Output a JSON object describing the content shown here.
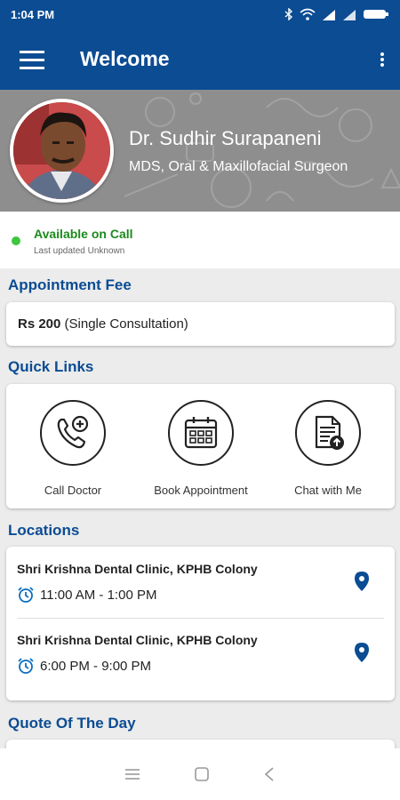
{
  "status_bar": {
    "time": "1:04 PM",
    "icons": [
      "bluetooth-icon",
      "wifi-icon",
      "signal-icon",
      "signal-icon",
      "battery-icon"
    ]
  },
  "app_bar": {
    "title": "Welcome"
  },
  "profile": {
    "name": "Dr. Sudhir Surapaneni",
    "degree": "MDS, Oral & Maxillofacial Surgeon"
  },
  "availability": {
    "status": "Available on Call",
    "updated": "Last updated Unknown",
    "status_color": "#3ec63e"
  },
  "appointment_fee": {
    "heading": "Appointment Fee",
    "amount": "Rs 200",
    "note": " (Single Consultation)"
  },
  "quick_links": {
    "heading": "Quick Links",
    "items": [
      {
        "label": "Call Doctor",
        "icon": "phone-plus-icon"
      },
      {
        "label": "Book Appointment",
        "icon": "calendar-icon"
      },
      {
        "label": "Chat with Me",
        "icon": "document-upload-icon"
      }
    ]
  },
  "locations": {
    "heading": "Locations",
    "items": [
      {
        "name": "Shri Krishna Dental Clinic, KPHB Colony",
        "time": "11:00 AM - 1:00 PM"
      },
      {
        "name": "Shri Krishna Dental Clinic, KPHB Colony",
        "time": "6:00 PM - 9:00 PM"
      }
    ]
  },
  "quote": {
    "heading": "Quote Of The Day"
  },
  "colors": {
    "primary": "#0b4c93",
    "accent": "#0b6fc2",
    "available": "#3ec63e"
  }
}
